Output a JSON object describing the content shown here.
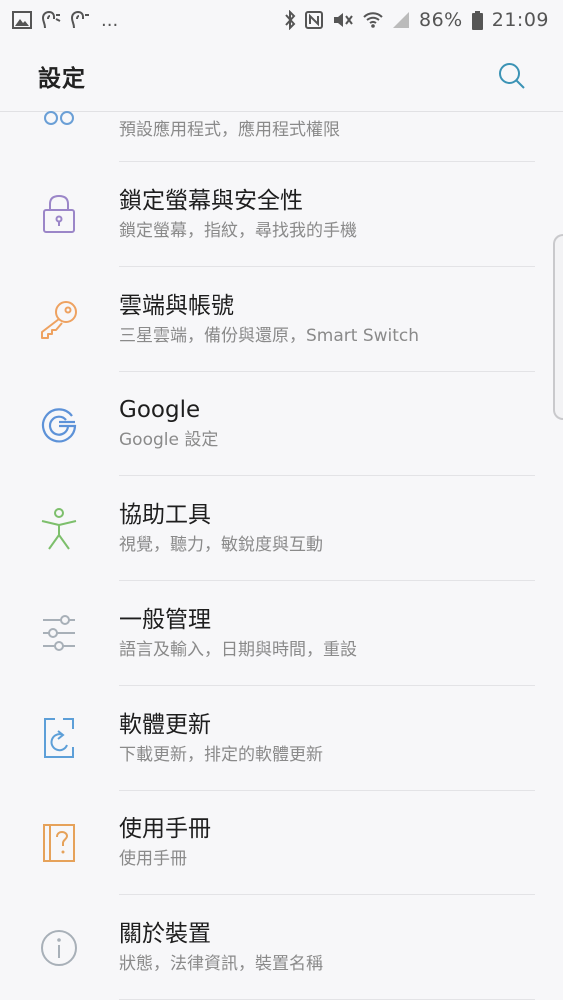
{
  "status_bar": {
    "battery": "86%",
    "time": "21:09",
    "more": "..."
  },
  "header": {
    "title": "設定"
  },
  "settings": [
    {
      "title": "",
      "subtitle": "預設應用程式，應用程式權限",
      "icon": "apps-icon",
      "color": "#6a9fd6"
    },
    {
      "title": "鎖定螢幕與安全性",
      "subtitle": "鎖定螢幕，指紋，尋找我的手機",
      "icon": "lock-icon",
      "color": "#9b86c8"
    },
    {
      "title": "雲端與帳號",
      "subtitle": "三星雲端，備份與還原，Smart Switch",
      "icon": "key-icon",
      "color": "#eea261"
    },
    {
      "title": "Google",
      "subtitle": "Google 設定",
      "icon": "google-icon",
      "color": "#5d92d8"
    },
    {
      "title": "協助工具",
      "subtitle": "視覺，聽力，敏銳度與互動",
      "icon": "accessibility-icon",
      "color": "#7dbf6c"
    },
    {
      "title": "一般管理",
      "subtitle": "語言及輸入，日期與時間，重設",
      "icon": "sliders-icon",
      "color": "#a8b0b8"
    },
    {
      "title": "軟體更新",
      "subtitle": "下載更新，排定的軟體更新",
      "icon": "software-update-icon",
      "color": "#5d9fd8"
    },
    {
      "title": "使用手冊",
      "subtitle": "使用手冊",
      "icon": "manual-icon",
      "color": "#e6a25a"
    },
    {
      "title": "關於裝置",
      "subtitle": "狀態，法律資訊，裝置名稱",
      "icon": "info-icon",
      "color": "#a8b0b8"
    }
  ]
}
